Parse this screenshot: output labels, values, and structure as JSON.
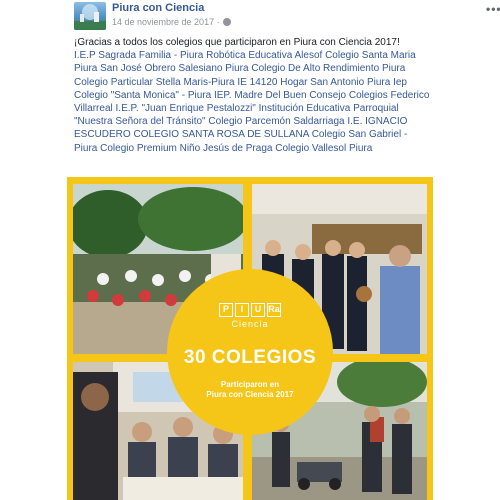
{
  "post": {
    "page_name": "Piura con Ciencia",
    "date": "14 de noviembre de 2017",
    "more_label": "•••",
    "privacy_icon": "globe-icon"
  },
  "message": {
    "intro": "¡Gracias a todos los colegios que participaron en Piura con Ciencia 2017!",
    "school_1": "I.E.P Sagrada Familia - Piura",
    "school_2": "Robótica Educativa Alesof",
    "school_3": "Colegio Santa Maria Piura",
    "school_4": "San José Obrero Salesiano Piura",
    "school_5": "Colegio De Alto Rendimiento Piura",
    "school_6": "Colegio Particular Stella Maris-Piura",
    "school_7": "IE 14120 Hogar San Antonio Piura",
    "school_8": "Iep Colegio \"Santa Monica\" - Piura",
    "school_9": "IEP. Madre Del Buen Consejo",
    "school_10": "Colegios Federico Villarreal",
    "school_11": "I.E.P. \"Juan Enrique Pestalozzi\"",
    "school_12": "Institución Educativa Parroquial \"Nuestra Señora del Tránsito\"",
    "school_13": "Colegio Parcemón Saldarriaga",
    "school_14": "I.E. IGNACIO ESCUDERO",
    "school_15": "COLEGIO SANTA ROSA DE SULLANA",
    "school_16": "Colegio San Gabriel - Piura",
    "school_17": "Colegio Premium Niño Jesús de Praga",
    "school_18": "Colegio Vallesol Piura"
  },
  "collage": {
    "logo_letters": [
      "P",
      "I",
      "U",
      "Ra"
    ],
    "logo_subtitle": "Ciencia",
    "title": "30 COLEGIOS",
    "subtitle_line_1": "Participaron en",
    "subtitle_line_2": "Piura con Ciencia 2017",
    "accent_color": "#f5c518"
  },
  "colors": {
    "link": "#365899",
    "text": "#1c1e21",
    "meta": "#90949c"
  }
}
